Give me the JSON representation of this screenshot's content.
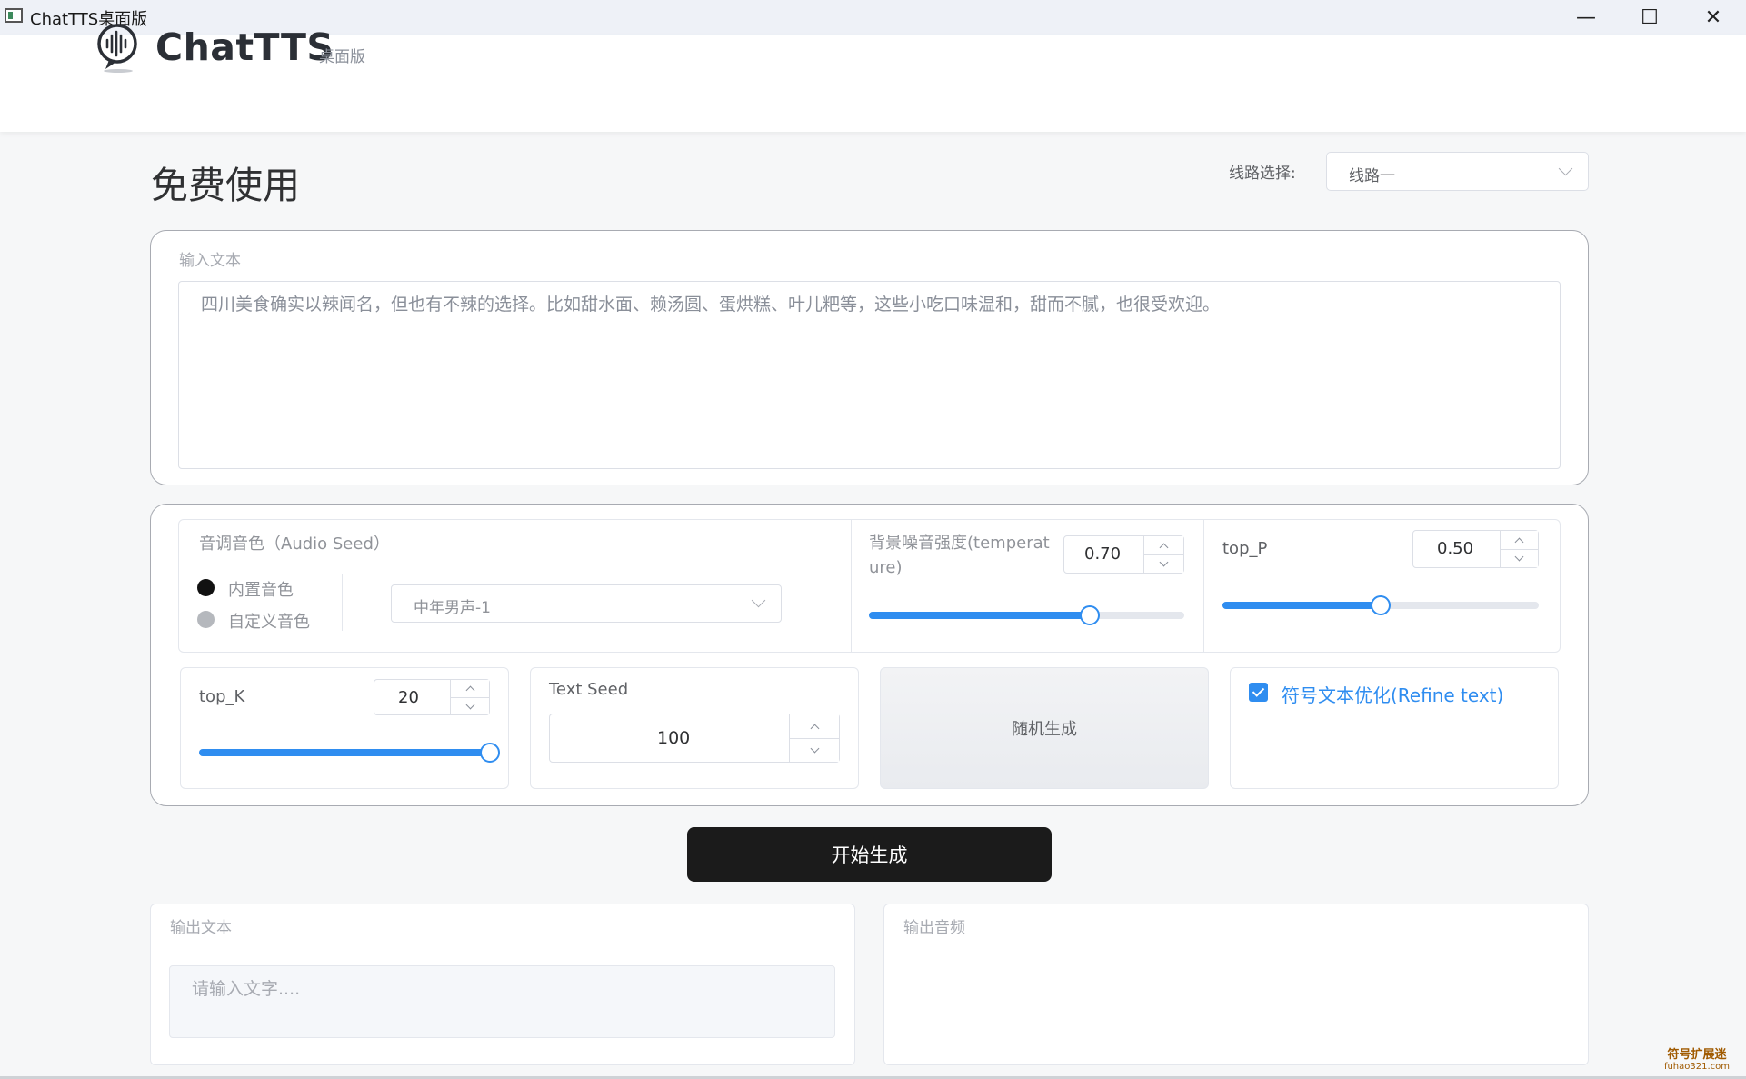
{
  "window": {
    "title": "ChatTTS桌面版",
    "minimize_glyph": "—",
    "maximize_glyph": "☐",
    "close_glyph": "✕"
  },
  "header": {
    "brand": "ChatTTS",
    "brand_sub": "桌面版"
  },
  "page_title": "免费使用",
  "route": {
    "label": "线路选择:",
    "value": "线路一"
  },
  "input": {
    "label": "输入文本",
    "text": "四川美食确实以辣闻名，但也有不辣的选择。比如甜水面、赖汤圆、蛋烘糕、叶儿粑等，这些小吃口味温和，甜而不腻，也很受欢迎。"
  },
  "audio_seed": {
    "label": "音调音色（Audio Seed）",
    "radio_builtin": "内置音色",
    "radio_custom": "自定义音色",
    "voice_value": "中年男声-1"
  },
  "temperature": {
    "label": "背景噪音强度(temperature)",
    "value": "0.70",
    "fraction": 0.7
  },
  "top_p": {
    "label": "top_P",
    "value": "0.50",
    "fraction": 0.5
  },
  "top_k": {
    "label": "top_K",
    "value": "20",
    "fraction": 1.0
  },
  "text_seed": {
    "label": "Text Seed",
    "value": "100"
  },
  "random_button": "随机生成",
  "refine": {
    "label": "符号文本优化(Refine text)",
    "checked": true
  },
  "start_button": "开始生成",
  "output": {
    "text_label": "输出文本",
    "text_placeholder": "请输入文字....",
    "audio_label": "输出音频"
  },
  "watermark": {
    "main": "符号扩展迷",
    "sub": "fuhao321.com"
  },
  "colors": {
    "accent": "#2f8df0",
    "start_button": "#1b1b1b"
  }
}
